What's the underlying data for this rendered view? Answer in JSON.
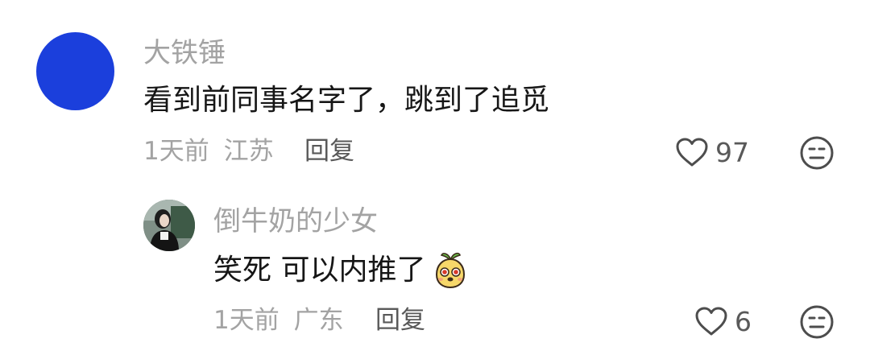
{
  "comments": [
    {
      "username": "大铁锤",
      "text": "看到前同事名字了，跳到了追觅",
      "time": "1天前",
      "location": "江苏",
      "reply_label": "回复",
      "likes": "97",
      "avatar_color": "#1b3fdc"
    },
    {
      "username": "倒牛奶的少女",
      "text": "笑死 可以内推了",
      "sticker": "sprout-face-sticker",
      "time": "1天前",
      "location": "广东",
      "reply_label": "回复",
      "likes": "6"
    }
  ],
  "icons": {
    "like": "heart-outline-icon",
    "dislike": "meh-face-icon"
  }
}
